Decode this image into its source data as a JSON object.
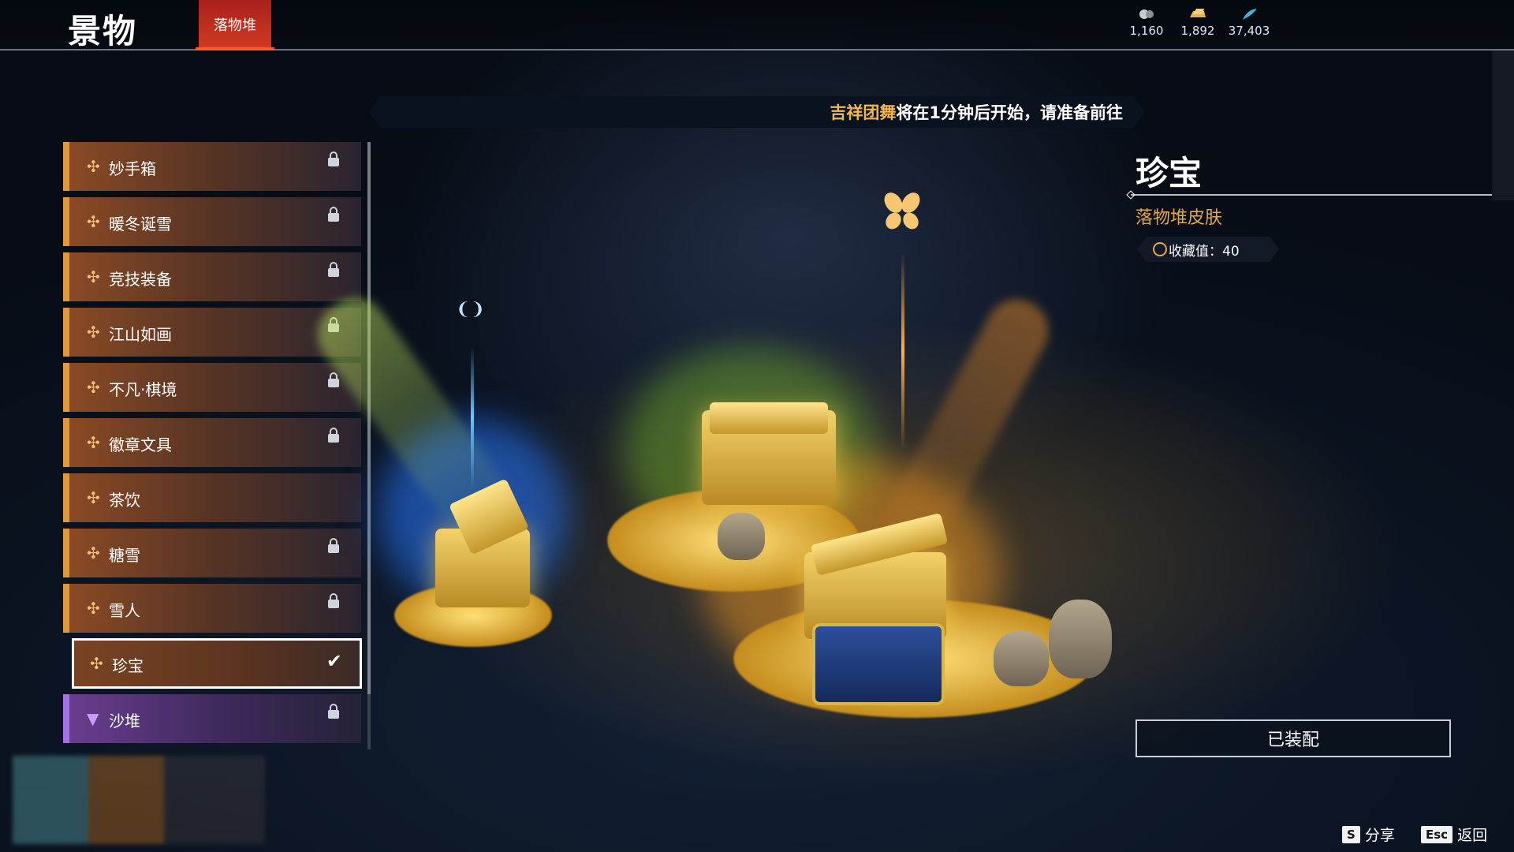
{
  "header": {
    "title": "景物",
    "active_tab": "落物堆",
    "currencies": [
      {
        "icon": "orb-currency-icon",
        "value": "1,160",
        "color": "#c8ccd4"
      },
      {
        "icon": "gold-bar-currency-icon",
        "value": "1,892",
        "color": "#e6b54a"
      },
      {
        "icon": "feather-currency-icon",
        "value": "37,403",
        "color": "#3fb7d9"
      }
    ]
  },
  "banner": {
    "highlight": "吉祥团舞",
    "text": "将在1分钟后开始，请准备前往"
  },
  "list": {
    "items": [
      {
        "label": "妙手箱",
        "locked": true,
        "rarity": "orange"
      },
      {
        "label": "暖冬诞雪",
        "locked": true,
        "rarity": "orange"
      },
      {
        "label": "竞技装备",
        "locked": true,
        "rarity": "orange"
      },
      {
        "label": "江山如画",
        "locked": true,
        "rarity": "orange"
      },
      {
        "label": "不凡·棋境",
        "locked": true,
        "rarity": "orange"
      },
      {
        "label": "徽章文具",
        "locked": true,
        "rarity": "orange"
      },
      {
        "label": "茶饮",
        "locked": false,
        "rarity": "orange"
      },
      {
        "label": "糖雪",
        "locked": true,
        "rarity": "orange"
      },
      {
        "label": "雪人",
        "locked": true,
        "rarity": "orange"
      },
      {
        "label": "珍宝",
        "locked": false,
        "rarity": "orange",
        "selected": true,
        "equipped": true
      },
      {
        "label": "沙堆",
        "locked": true,
        "rarity": "purple"
      }
    ]
  },
  "detail": {
    "name": "珍宝",
    "subtype": "落物堆皮肤",
    "collect_label": "收藏值",
    "collect_value": "40",
    "collect_text": "收藏值：40",
    "equip_button": "已装配"
  },
  "footer": {
    "share_key": "S",
    "share_label": "分享",
    "back_key": "Esc",
    "back_label": "返回"
  },
  "colors": {
    "accent_red": "#d23a22",
    "accent_gold": "#e6a64a",
    "rarity_orange": "#e09a3c",
    "rarity_purple": "#a571e6"
  }
}
